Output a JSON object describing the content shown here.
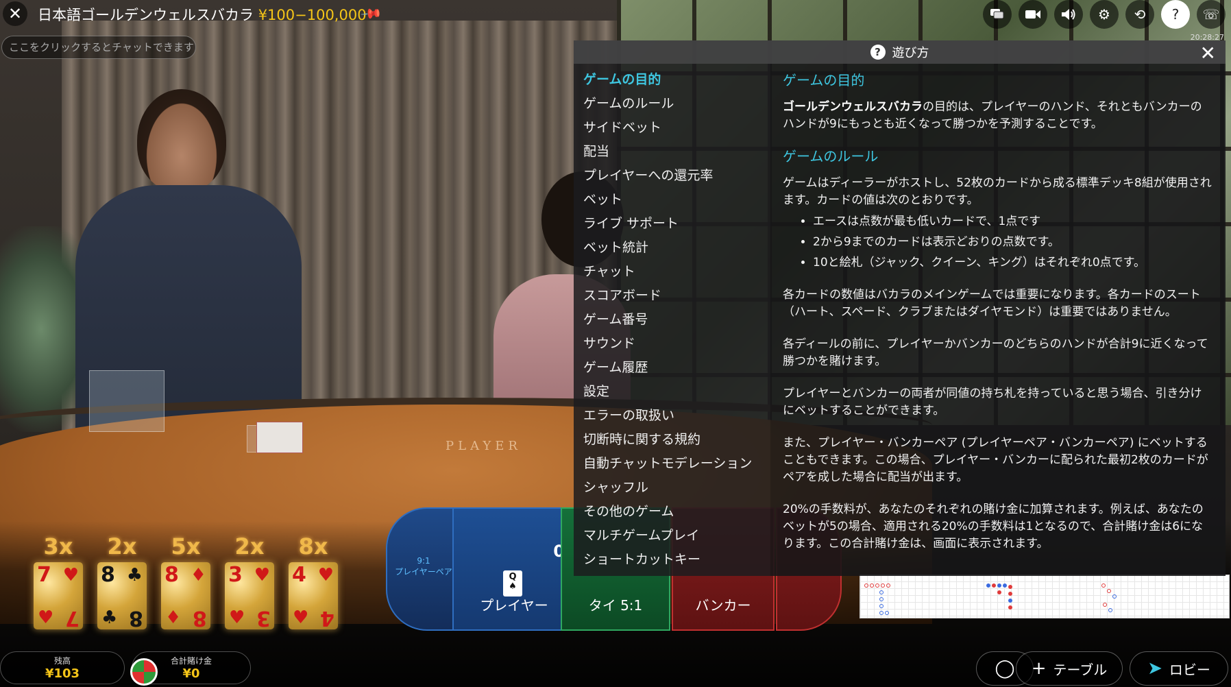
{
  "header": {
    "title": "日本語ゴールデンウェルスバカラ",
    "limits": "¥100−100,000",
    "chat_placeholder": "ここをクリックするとチャットできます",
    "clock": "20:28:27",
    "icons": [
      "chat-icon",
      "video-icon",
      "volume-icon",
      "gear-icon",
      "history-icon",
      "help-icon",
      "headset-icon"
    ]
  },
  "help": {
    "title": "遊び方",
    "nav": [
      "ゲームの目的",
      "ゲームのルール",
      "サイドベット",
      "配当",
      "プレイヤーへの還元率",
      "ベット",
      "ライブ サポート",
      "ベット統計",
      "チャット",
      "スコアボード",
      "ゲーム番号",
      "サウンド",
      "ゲーム履歴",
      "設定",
      "エラーの取扱い",
      "切断時に関する規約",
      "自動チャットモデレーション",
      "シャッフル",
      "その他のゲーム",
      "マルチゲームプレイ",
      "ショートカットキー"
    ],
    "active_nav": "ゲームの目的",
    "content": {
      "s1_title": "ゲームの目的",
      "s1_bold": "ゴールデンウェルスバカラ",
      "s1_text": "の目的は、プレイヤーのハンド、それともバンカーのハンドが9にもっとも近くなって勝つかを予測することです。",
      "s2_title": "ゲームのルール",
      "s2_p1": "ゲームはディーラーがホストし、52枚のカードから成る標準デッキ8組が使用されます。カードの値は次のとおりです。",
      "s2_list": [
        "エースは点数が最も低いカードで、1点です",
        "2から9までのカードは表示どおりの点数です。",
        "10と絵札（ジャック、クイーン、キング）はそれぞれ0点です。"
      ],
      "s2_p2": "各カードの数値はバカラのメインゲームでは重要になります。各カードのスート（ハート、スペード、クラブまたはダイヤモンド）は重要ではありません。",
      "s2_p3": "各ディールの前に、プレイヤーかバンカーのどちらのハンドが合計9に近くなって勝つかを賭けます。",
      "s2_p4": "プレイヤーとバンカーの両者が同値の持ち札を持っていると思う場合、引き分けにベットすることができます。",
      "s2_p5": "また、プレイヤー・バンカーペア (プレイヤーペア・バンカーペア) にベットすることもできます。この場合、プレイヤー・バンカーに配られた最初2枚のカードがペアを成した場合に配当が出ます。",
      "s2_p6": "20%の手数料が、あなたのそれぞれの賭け金に加算されます。例えば、あなたのベットが5の場合、適用される20%の手数料は1となるので、合計賭け金は6になります。この合計賭け金は、画面に表示されます。"
    }
  },
  "table": {
    "table_text": "PLAYER",
    "player_pair": "9:1\nプレイヤーペア",
    "player_pair_ratio": "9:1",
    "player_pair_label": "プレイヤーペア",
    "player_label": "プレイヤー",
    "player_score": "0",
    "player_card": "Q",
    "tie_label": "タイ 5:1",
    "banker_label": "バンカー"
  },
  "lucky_cards": [
    {
      "mult": "3x",
      "rank": "7",
      "suit": "♥",
      "color": "red"
    },
    {
      "mult": "2x",
      "rank": "8",
      "suit": "♣",
      "color": "black"
    },
    {
      "mult": "5x",
      "rank": "8",
      "suit": "♦",
      "color": "red"
    },
    {
      "mult": "2x",
      "rank": "3",
      "suit": "♥",
      "color": "red"
    },
    {
      "mult": "8x",
      "rank": "4",
      "suit": "♥",
      "color": "red"
    }
  ],
  "footer": {
    "balance_label": "残高",
    "balance_value": "¥103",
    "totalbet_label": "合計賭け金",
    "totalbet_value": "¥0",
    "table_button": "テーブル",
    "lobby_button": "ロビー"
  },
  "colors": {
    "accent": "#3ec6e0",
    "limits": "#f5c518"
  }
}
